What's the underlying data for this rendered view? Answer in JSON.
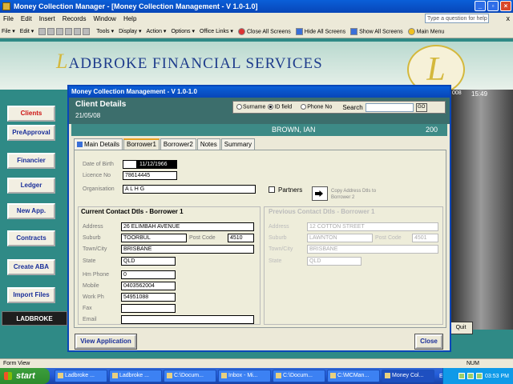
{
  "window": {
    "title": "Money Collection Manager - [Money Collection Management - V 1.0-1.0]"
  },
  "menu": {
    "items": [
      "File",
      "Edit",
      "Insert",
      "Records",
      "Window",
      "Help"
    ],
    "help_placeholder": "Type a question for help",
    "close_glyph": "x"
  },
  "toolbar": {
    "file": "File ▾",
    "edit": "Edit ▾",
    "tools": "Tools ▾",
    "display": "Display ▾",
    "action": "Action ▾",
    "options": "Options ▾",
    "office_links": "Office Links ▾",
    "close_all": "Close All Screens",
    "hide_all": "Hide All Screens",
    "show_all": "Show All Screens",
    "main_menu": "Main Menu"
  },
  "banner": {
    "title_big": "L",
    "title_rest": "ADBROKE FINANCIAL SERVICES",
    "logo_letter": "L",
    "date": "008",
    "time": "15:49"
  },
  "sidebar": {
    "buttons": [
      "Clients",
      "PreApproval",
      "Financier",
      "Ledger",
      "New App.",
      "Contracts",
      "Create ABA",
      "Import Files"
    ],
    "footer": "LADBROKE"
  },
  "quit_label": "Quit",
  "dialog": {
    "title": "Money Collection Management - V 1.0-1.0",
    "header_title": "Client Details",
    "header_date": "21/05/08",
    "search": {
      "options": [
        "Surname",
        "ID field",
        "Phone No"
      ],
      "selected": "ID field",
      "label": "Search",
      "go": "GO"
    },
    "client_name": "BROWN, IAN",
    "client_id": "200",
    "tabs": [
      "Main Details",
      "Borrower1",
      "Borrower2",
      "Notes",
      "Summary"
    ],
    "active_tab": "Borrower1",
    "borrower": {
      "dob_label": "Date of Birth",
      "dob": "11/12/1966",
      "licence_label": "Licence No",
      "licence": "78614445",
      "org_label": "Organisation",
      "org": "A L H G",
      "partners_label": "Partners",
      "copy_label": "Copy Address Dtls to Borrower 2"
    },
    "current": {
      "title": "Current Contact Dtls - Borrower 1",
      "address_label": "Address",
      "address": "26 ELIMBAH AVENUE",
      "suburb_label": "Suburb",
      "suburb": "TOORBUL",
      "postcode_label": "Post Code",
      "postcode": "4510",
      "town_label": "Town/City",
      "town": "BRISBANE",
      "state_label": "State",
      "state": "QLD",
      "hm_phone_label": "Hm Phone",
      "hm_phone": "0",
      "mobile_label": "Mobile",
      "mobile": "0403562004",
      "work_ph_label": "Work Ph",
      "work_ph": "54951088",
      "fax_label": "Fax",
      "fax": "",
      "email_label": "Email",
      "email": ""
    },
    "previous": {
      "title": "Previous Contact Dtls - Borrower 1",
      "address_label": "Address",
      "address": "12 COTTON STREET",
      "suburb_label": "Suburb",
      "suburb": "LAWNTON",
      "postcode_label": "Post Code",
      "postcode": "4501",
      "town_label": "Town/City",
      "town": "BRISBANE",
      "state_label": "State",
      "state": "QLD"
    },
    "view_app": "View Application",
    "close": "Close"
  },
  "statusbar": {
    "left": "Form View",
    "num": "NUM"
  },
  "taskbar": {
    "start": "start",
    "tasks": [
      "Ladbroke ...",
      "Ladbroke ...",
      "C:\\Docum...",
      "Inbox - Mi...",
      "C:\\Docum...",
      "C:\\MCMan...",
      "Money Col..."
    ],
    "active_index": 6,
    "lang": "EN",
    "time": "03:53 PM"
  }
}
